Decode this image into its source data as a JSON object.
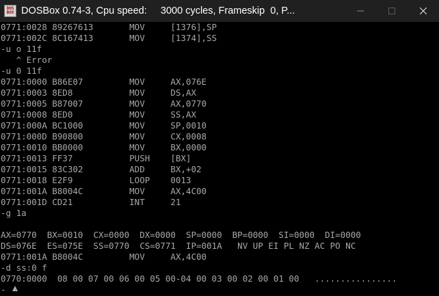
{
  "window": {
    "icon_top": "DOS",
    "icon_bottom": "BOX",
    "title": "DOSBox 0.74-3, Cpu speed:     3000 cycles, Frameskip  0, P...",
    "icons": [
      "minimize-icon",
      "maximize-icon",
      "close-icon"
    ]
  },
  "console": {
    "lines": [
      "0771:0028 89267613       MOV     [1376],SP",
      "0771:002C 8C167413       MOV     [1374],SS",
      "-u o 11f",
      "   ^ Error",
      "-u 0 11f",
      "0771:0000 B86E07         MOV     AX,076E",
      "0771:0003 8ED8           MOV     DS,AX",
      "0771:0005 B87007         MOV     AX,0770",
      "0771:0008 8ED0           MOV     SS,AX",
      "0771:000A BC1000         MOV     SP,0010",
      "0771:000D B90800         MOV     CX,0008",
      "0771:0010 BB0000         MOV     BX,0000",
      "0771:0013 FF37           PUSH    [BX]",
      "0771:0015 83C302         ADD     BX,+02",
      "0771:0018 E2F9           LOOP    0013",
      "0771:001A B8004C         MOV     AX,4C00",
      "0771:001D CD21           INT     21",
      "-g 1a",
      "",
      "AX=0770  BX=0010  CX=0000  DX=0000  SP=0000  BP=0000  SI=0000  DI=0000",
      "DS=076E  ES=075E  SS=0770  CS=0771  IP=001A   NV UP EI PL NZ AC PO NC",
      "0771:001A B8004C         MOV     AX,4C00",
      "-d ss:0 f",
      "0770:0000  08 00 07 00 06 00 05 00-04 00 03 00 02 00 01 00   ................",
      "-"
    ]
  }
}
